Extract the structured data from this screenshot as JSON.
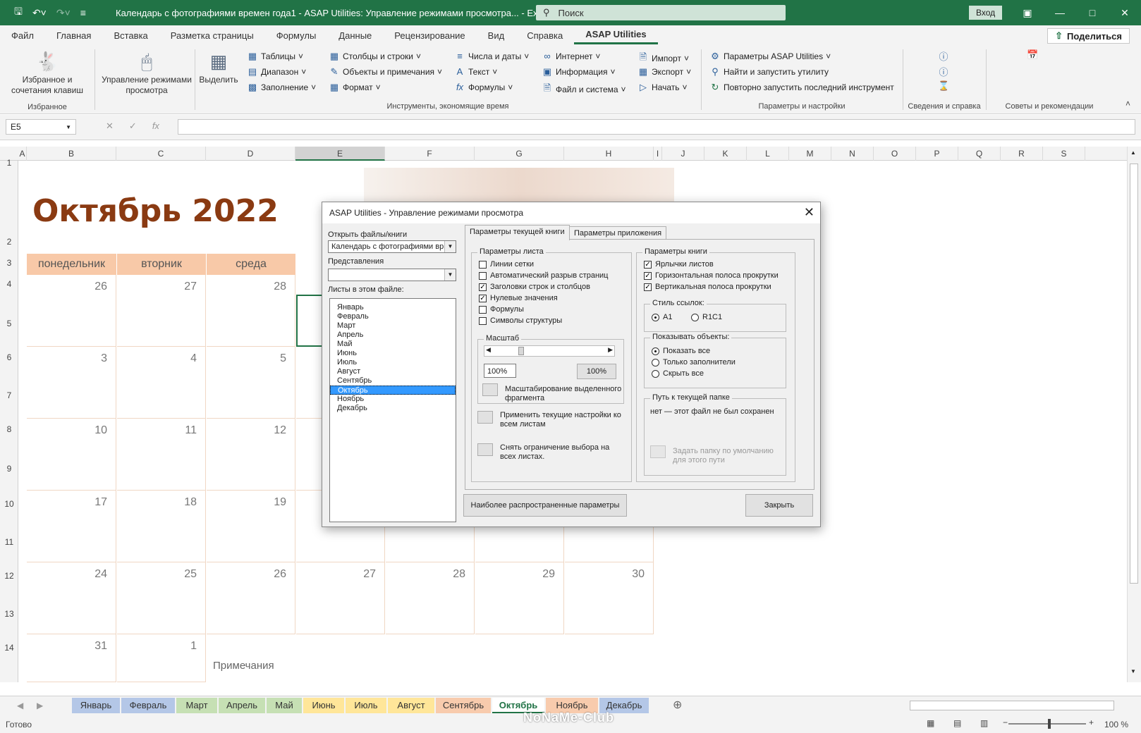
{
  "titlebar": {
    "title": "Календарь с фотографиями времен года1  -  ASAP Utilities: Управление режимами просмотра...  -  Excel",
    "search_placeholder": "Поиск",
    "login_label": "Вход"
  },
  "tabs": [
    "Файл",
    "Главная",
    "Вставка",
    "Разметка страницы",
    "Формулы",
    "Данные",
    "Рецензирование",
    "Вид",
    "Справка",
    "ASAP Utilities"
  ],
  "share_label": "Поделиться",
  "ribbon": {
    "fav_label": "Избранное и сочетания клавиш",
    "fav_group": "Избранное",
    "view_label": "Управление режимами просмотра",
    "select_label": "Выделить",
    "col1": [
      "Таблицы",
      "Диапазон",
      "Заполнение"
    ],
    "col2": [
      "Столбцы и строки",
      "Объекты и примечания",
      "Формат"
    ],
    "col3": [
      "Числа и даты",
      "Текст",
      "Формулы"
    ],
    "col4": [
      "Интернет",
      "Информация",
      "Файл и система"
    ],
    "col5": [
      "Импорт",
      "Экспорт",
      "Начать"
    ],
    "timesave_group": "Инструменты, экономящие время",
    "col6": [
      "Параметры ASAP Utilities",
      "Найти и запустить утилиту",
      "Повторно запустить последний инструмент"
    ],
    "settings_group": "Параметры и настройки",
    "info_group": "Сведения и справка",
    "tips_group": "Советы и рекомендации"
  },
  "namebox": "E5",
  "fx_label": "fx",
  "columns": [
    "A",
    "B",
    "C",
    "D",
    "E",
    "F",
    "G",
    "H",
    "I",
    "J",
    "K",
    "L",
    "M",
    "N",
    "O",
    "P",
    "Q",
    "R",
    "S"
  ],
  "rows": [
    "1",
    "2",
    "3",
    "4",
    "5",
    "6",
    "7",
    "8",
    "9",
    "10",
    "11",
    "12",
    "13",
    "14"
  ],
  "calendar": {
    "title": "Октябрь 2022",
    "weekdays": [
      "понедельник",
      "вторник",
      "среда"
    ],
    "weeks": [
      [
        "26",
        "27",
        "28",
        "",
        "",
        "",
        ""
      ],
      [
        "3",
        "4",
        "5",
        "",
        "",
        "",
        ""
      ],
      [
        "10",
        "11",
        "12",
        "",
        "",
        "",
        ""
      ],
      [
        "17",
        "18",
        "19",
        "",
        "",
        "",
        ""
      ],
      [
        "24",
        "25",
        "26",
        "27",
        "28",
        "29",
        "30"
      ],
      [
        "31",
        "1",
        "",
        "",
        "",
        "",
        ""
      ]
    ],
    "notes": "Примечания"
  },
  "sheet_tabs": [
    {
      "name": "Январь",
      "color": "#b4c7e7"
    },
    {
      "name": "Февраль",
      "color": "#b4c7e7"
    },
    {
      "name": "Март",
      "color": "#c6e0b4"
    },
    {
      "name": "Апрель",
      "color": "#c6e0b4"
    },
    {
      "name": "Май",
      "color": "#c6e0b4"
    },
    {
      "name": "Июнь",
      "color": "#ffe699"
    },
    {
      "name": "Июль",
      "color": "#ffe699"
    },
    {
      "name": "Август",
      "color": "#ffe699"
    },
    {
      "name": "Сентябрь",
      "color": "#f8cbad"
    },
    {
      "name": "Октябрь",
      "color": "#ffffff"
    },
    {
      "name": "Ноябрь",
      "color": "#f8cbad"
    },
    {
      "name": "Декабрь",
      "color": "#b4c7e7"
    }
  ],
  "status": {
    "ready": "Готово",
    "zoom": "100 %"
  },
  "watermark": "NoNaMe-Club",
  "dialog": {
    "title": "ASAP Utilities - Управление режимами просмотра",
    "open_files_label": "Открыть файлы/книги",
    "open_files_value": "Календарь с фотографиями вр",
    "views_label": "Представления",
    "sheets_label": "Листы в этом файле:",
    "sheets": [
      "Январь",
      "Февраль",
      "Март",
      "Апрель",
      "Май",
      "Июнь",
      "Июль",
      "Август",
      "Сентябрь",
      "Октябрь",
      "Ноябрь",
      "Декабрь"
    ],
    "selected_sheet": "Октябрь",
    "tab_current": "Параметры текущей книги",
    "tab_app": "Параметры приложения",
    "sheet_params_title": "Параметры листа",
    "sheet_params": [
      {
        "label": "Линии сетки",
        "checked": false
      },
      {
        "label": "Автоматический разрыв страниц",
        "checked": false
      },
      {
        "label": "Заголовки строк и столбцов",
        "checked": true
      },
      {
        "label": "Нулевые значения",
        "checked": true
      },
      {
        "label": "Формулы",
        "checked": false
      },
      {
        "label": "Символы структуры",
        "checked": false
      }
    ],
    "zoom_title": "Масштаб",
    "zoom_value": "100%",
    "zoom_button": "100%",
    "zoom_selection": "Масштабирование выделенного фрагмента",
    "apply_all": "Применить текущие настройки ко всем листам",
    "unlock_selection": "Снять ограничение выбора на всех листах.",
    "book_params_title": "Параметры книги",
    "book_params": [
      {
        "label": "Ярлычки листов",
        "checked": true
      },
      {
        "label": "Горизонтальная полоса прокрутки",
        "checked": true
      },
      {
        "label": "Вертикальная полоса прокрутки",
        "checked": true
      }
    ],
    "ref_style_title": "Стиль ссылок:",
    "ref_a1": "A1",
    "ref_r1c1": "R1C1",
    "show_objects_title": "Показывать объекты:",
    "show_objects": [
      "Показать все",
      "Только заполнители",
      "Скрыть все"
    ],
    "path_title": "Путь к текущей папке",
    "path_value": "нет — этот файл не был сохранен",
    "set_default_folder": "Задать папку по умолчанию для этого пути",
    "common_params_button": "Наиболее распространенные параметры",
    "close_button": "Закрыть"
  }
}
